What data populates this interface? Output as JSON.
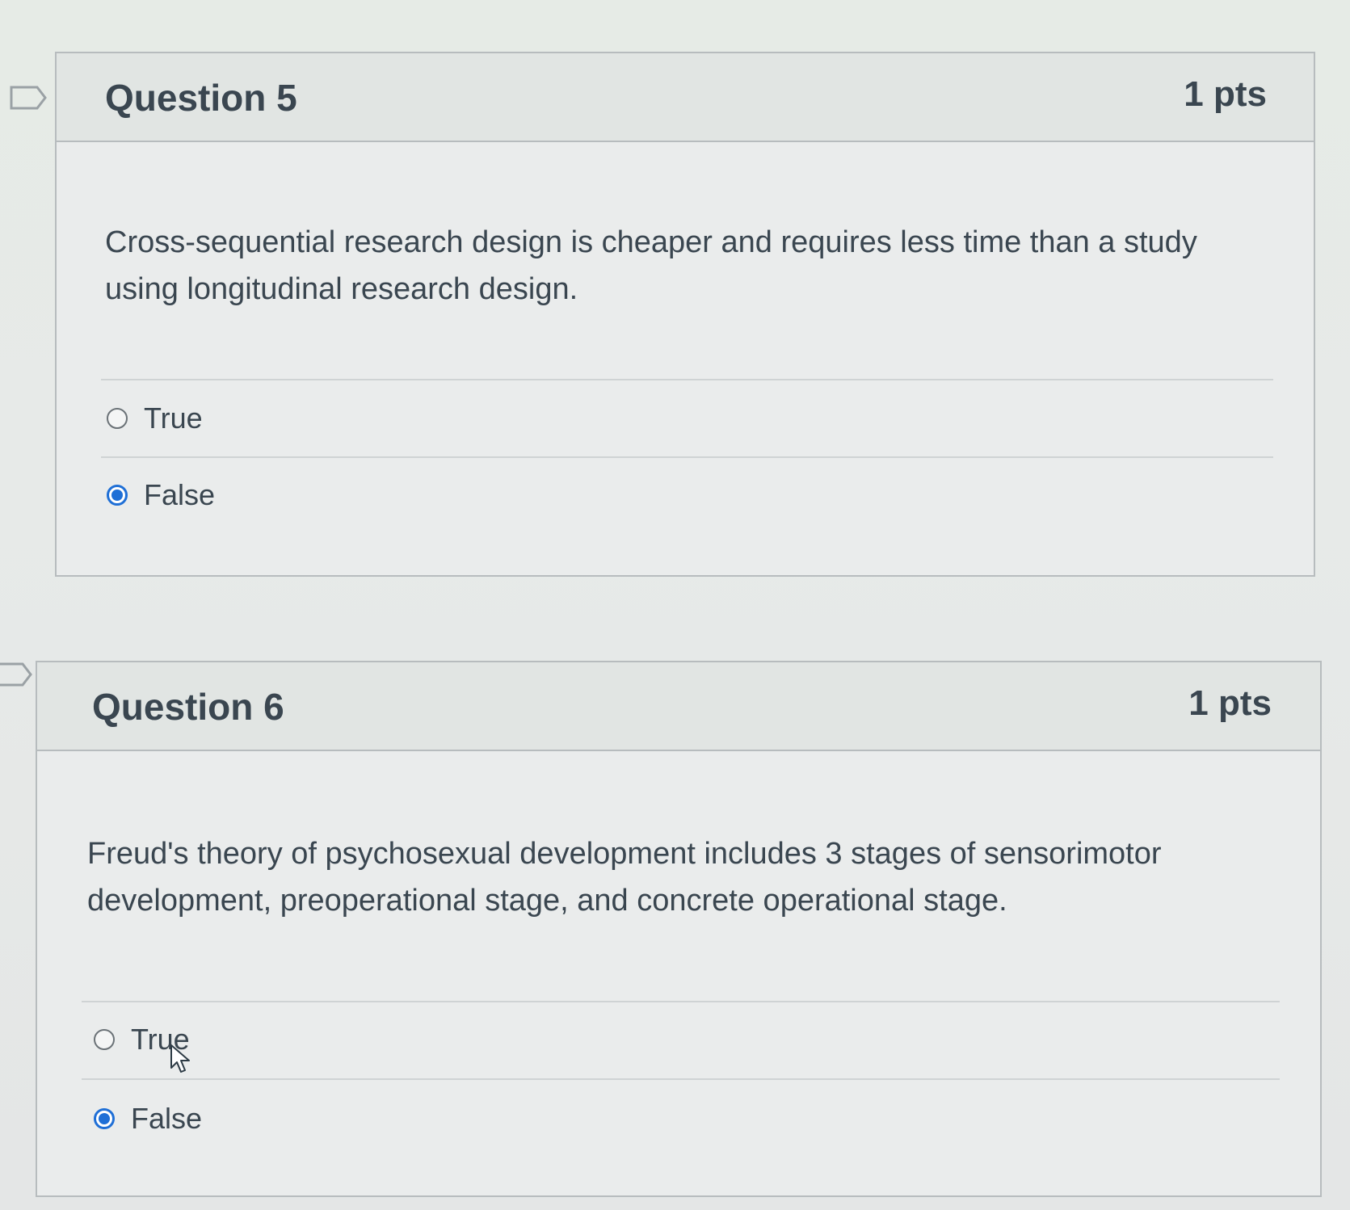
{
  "questions": [
    {
      "title": "Question 5",
      "points": "1 pts",
      "text": "Cross-sequential research design is cheaper and requires less time than a study using longitudinal research design.",
      "answers": [
        {
          "label": "True",
          "selected": false
        },
        {
          "label": "False",
          "selected": true
        }
      ]
    },
    {
      "title": "Question 6",
      "points": "1 pts",
      "text": "Freud's theory of psychosexual development includes 3 stages of sensorimotor development, preoperational stage, and concrete operational stage.",
      "answers": [
        {
          "label": "True",
          "selected": false
        },
        {
          "label": "False",
          "selected": true
        }
      ]
    }
  ],
  "icons": {
    "flag": "flag-icon",
    "radio": "radio-icon",
    "cursor": "mouse-pointer-icon"
  },
  "colors": {
    "accent": "#1f6fd6",
    "text": "#3a4650",
    "border": "#b7bcbe"
  }
}
